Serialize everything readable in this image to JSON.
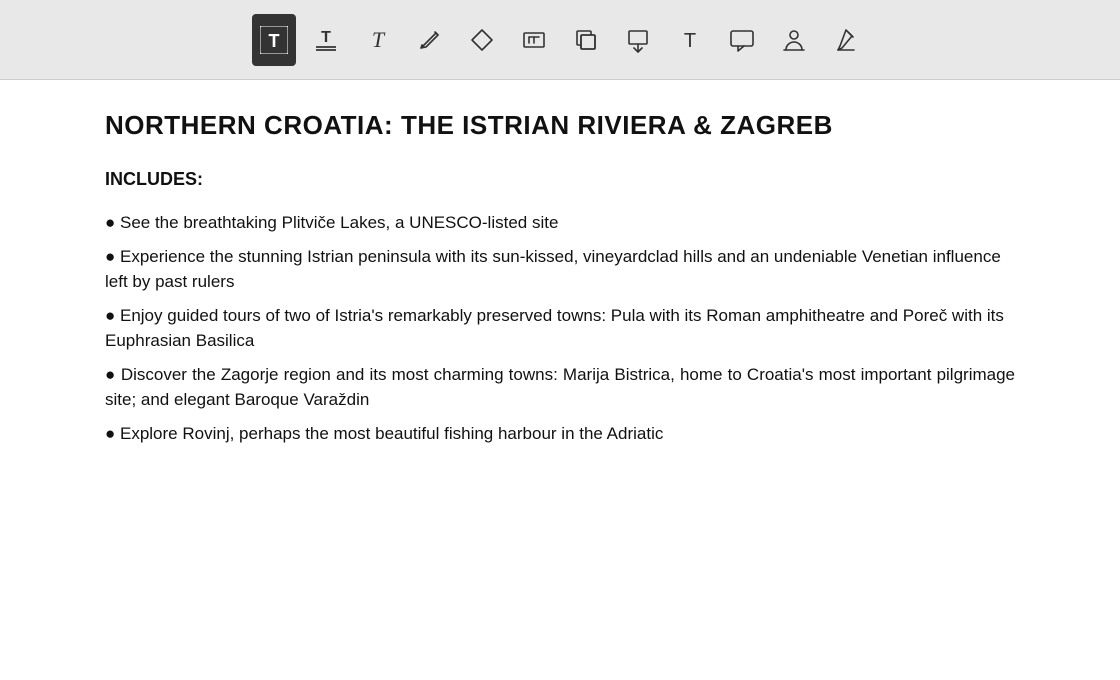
{
  "toolbar": {
    "tools": [
      {
        "id": "text-filled",
        "label": "Text (filled)",
        "active": true
      },
      {
        "id": "text-strikethrough",
        "label": "Text with strikethrough",
        "active": false
      },
      {
        "id": "text-plain",
        "label": "Text plain",
        "active": false
      },
      {
        "id": "pencil",
        "label": "Pencil/Edit",
        "active": false
      },
      {
        "id": "eraser",
        "label": "Eraser",
        "active": false
      },
      {
        "id": "text-box",
        "label": "Text Box",
        "active": false
      },
      {
        "id": "copy",
        "label": "Copy/Clone",
        "active": false
      },
      {
        "id": "move-down",
        "label": "Move Down",
        "active": false
      },
      {
        "id": "text-alt",
        "label": "Text Alt",
        "active": false
      },
      {
        "id": "comment",
        "label": "Comment",
        "active": false
      },
      {
        "id": "stamp",
        "label": "Stamp",
        "active": false
      },
      {
        "id": "pen",
        "label": "Pen/Signature",
        "active": false
      }
    ]
  },
  "content": {
    "title": "NORTHERN CROATIA: THE ISTRIAN RIVIERA & ZAGREB",
    "includes_label": "INCLUDES:",
    "bullet_items": [
      "● See the breathtaking Plitviče Lakes, a UNESCO-listed site",
      "● Experience the stunning Istrian peninsula with its sun-kissed, vineyardclad hills and an undeniable Venetian influence left by past rulers",
      "● Enjoy guided tours of two of Istria's remarkably preserved towns: Pula with its Roman amphitheatre and Poreč with its Euphrasian Basilica",
      "● Discover the Zagorje region and its most charming towns: Marija Bistrica, home to Croatia's most important pilgrimage site; and elegant Baroque Varaždin",
      "● Explore Rovinj, perhaps the most beautiful fishing harbour in the Adriatic"
    ]
  }
}
